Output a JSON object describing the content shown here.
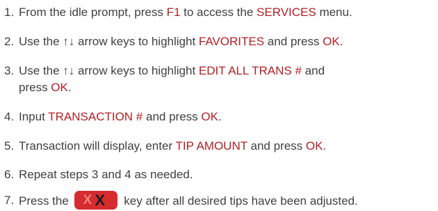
{
  "steps": [
    {
      "number": "1.",
      "parts": [
        "From the idle prompt, press ",
        "F1",
        " to access the ",
        "SERVICES",
        " menu."
      ]
    },
    {
      "number": "2.",
      "parts": [
        "Use the ↑↓ arrow keys to highlight ",
        "FAVORITES",
        " and press ",
        "OK",
        "."
      ]
    },
    {
      "number": "3.",
      "parts": [
        "Use the ↑↓ arrow keys to highlight ",
        "EDIT ALL TRANS #",
        " and"
      ],
      "line2": [
        "press ",
        "OK",
        "."
      ]
    },
    {
      "number": "4.",
      "parts": [
        "Input ",
        "TRANSACTION #",
        " and press ",
        "OK",
        "."
      ]
    },
    {
      "number": "5.",
      "parts": [
        "Transaction will display, enter ",
        "TIP AMOUNT",
        " and press ",
        "OK",
        "."
      ]
    },
    {
      "number": "6.",
      "parts": [
        "Repeat steps 3 and 4 as needed."
      ]
    },
    {
      "number": "7.",
      "before_key": "Press the ",
      "key_glyphs": [
        "X",
        "X"
      ],
      "after_key": " key after all desired tips have been adjusted."
    }
  ],
  "colors": {
    "body_text": "#3f3f3f",
    "keyword": "#b21f24",
    "key_bg": "#d62b2f"
  },
  "icons": {
    "cancel_key": "cancel-key-icon"
  }
}
